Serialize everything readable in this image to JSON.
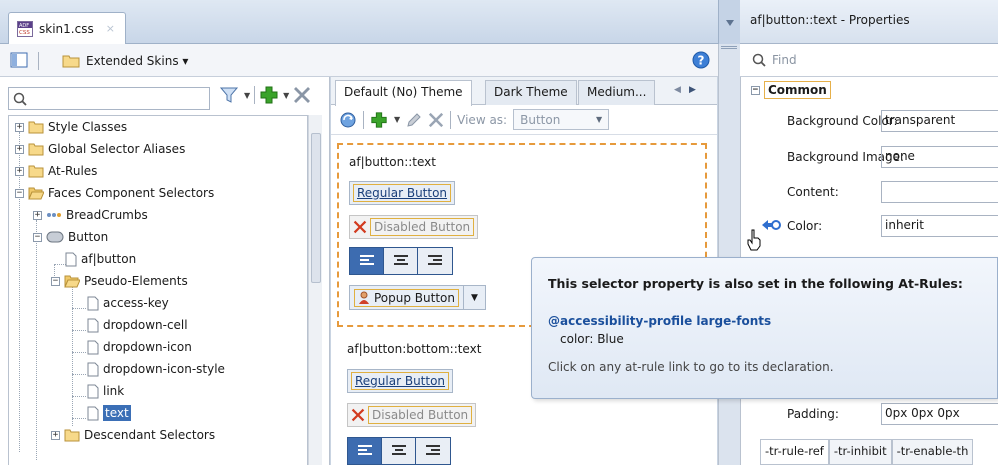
{
  "editor": {
    "file_tab": {
      "label": "skin1.css",
      "close": "×"
    },
    "skins_menu": {
      "label": "Extended Skins ▾"
    }
  },
  "left_panel": {
    "search": {
      "placeholder": ""
    },
    "tree": [
      {
        "label": "Style Classes"
      },
      {
        "label": "Global Selector Aliases"
      },
      {
        "label": "At-Rules"
      },
      {
        "label": "Faces Component Selectors"
      },
      {
        "label": "BreadCrumbs"
      },
      {
        "label": "Button"
      },
      {
        "label": "af|button"
      },
      {
        "label": "Pseudo-Elements"
      },
      {
        "label": "access-key"
      },
      {
        "label": "dropdown-cell"
      },
      {
        "label": "dropdown-icon"
      },
      {
        "label": "dropdown-icon-style"
      },
      {
        "label": "link"
      },
      {
        "label": "text",
        "selected": true
      },
      {
        "label": "Descendant Selectors"
      }
    ]
  },
  "middle_panel": {
    "theme_tabs": [
      {
        "label": "Default (No) Theme",
        "active": true
      },
      {
        "label": "Dark Theme"
      },
      {
        "label": "Medium..."
      }
    ],
    "view_as": {
      "label": "View as:",
      "value": "Button"
    },
    "previews": [
      {
        "selector": "af|button::text",
        "regular": "Regular Button",
        "disabled": "Disabled Button",
        "popup": "Popup Button"
      },
      {
        "selector": "af|button:bottom::text",
        "regular": "Regular Button",
        "disabled": "Disabled Button"
      }
    ]
  },
  "properties": {
    "title": "af|button::text - Properties",
    "find_placeholder": "Find",
    "section": "Common",
    "rows": [
      {
        "label": "Background Color:",
        "value": "transparent"
      },
      {
        "label": "Background Image:",
        "value": "none"
      },
      {
        "label": "Content:",
        "value": ""
      },
      {
        "label": "Color:",
        "value": "inherit"
      },
      {
        "label": "Padding:",
        "value": "0px 0px 0px"
      }
    ],
    "bottom_tabs": [
      "-tr-rule-ref",
      "-tr-inhibit",
      "-tr-enable-th"
    ]
  },
  "tooltip": {
    "title": "This selector property is also set in the following At-Rules:",
    "link": "@accessibility-profile large-fonts",
    "detail": "color: Blue",
    "hint": "Click on any at-rule link to go to its declaration."
  },
  "colors": {
    "selection": "#3b6fb6",
    "highlight_border": "#e69a3c",
    "link": "#1a4f9c",
    "add_green": "#3aa32a",
    "delete_gray": "#8a96a6",
    "disabled_x": "#d23a1e"
  }
}
